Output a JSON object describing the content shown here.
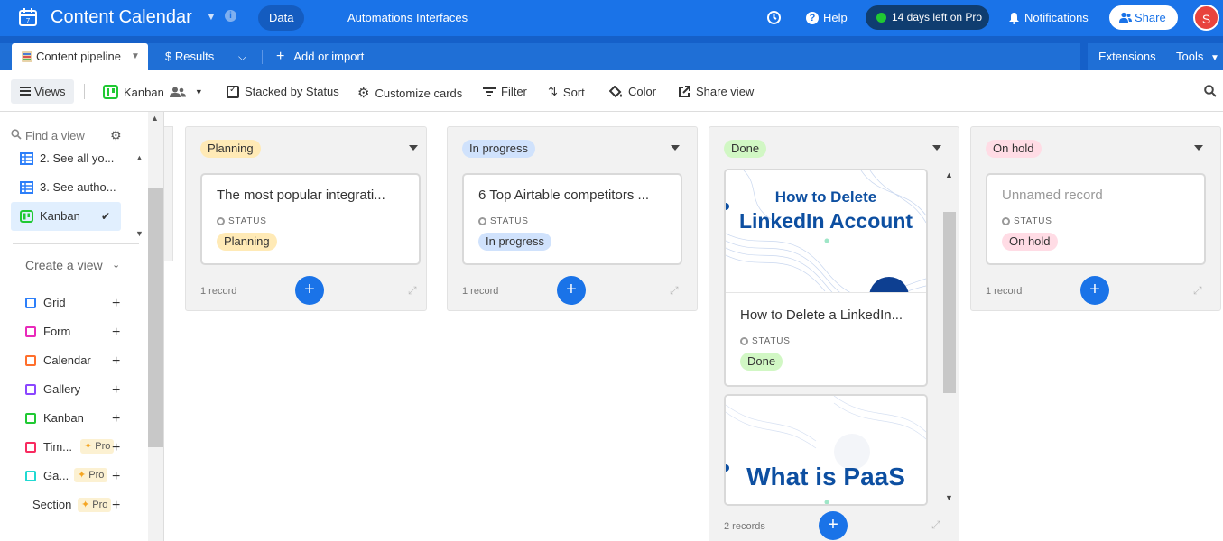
{
  "header": {
    "base_title": "Content Calendar",
    "nav": [
      {
        "label": "Data",
        "active": true
      },
      {
        "label": "Automations",
        "active": false
      },
      {
        "label": "Interfaces",
        "active": false
      }
    ],
    "help": "Help",
    "trial": "14 days left on Pro",
    "notifications": "Notifications",
    "share": "Share",
    "avatar_initial": "S",
    "accent": "#1a73e8"
  },
  "tables": {
    "active": "Content pipeline",
    "results": "$ Results",
    "add": "Add or import",
    "extensions": "Extensions",
    "tools": "Tools"
  },
  "toolbar": {
    "views": "Views",
    "view_name": "Kanban",
    "stacked": "Stacked by Status",
    "customize": "Customize cards",
    "filter": "Filter",
    "sort": "Sort",
    "color": "Color",
    "share_view": "Share view"
  },
  "sidebar": {
    "find_placeholder": "Find a view",
    "views": [
      {
        "label": "2. See all yo...",
        "icon": "grid-icon"
      },
      {
        "label": "3. See autho...",
        "icon": "grid-icon"
      },
      {
        "label": "Kanban",
        "icon": "kanban-icon",
        "selected": true
      }
    ],
    "create_label": "Create a view",
    "create_items": [
      {
        "label": "Grid",
        "color": "#2d7ff9"
      },
      {
        "label": "Form",
        "color": "#e929ba"
      },
      {
        "label": "Calendar",
        "color": "#ff6f2c"
      },
      {
        "label": "Gallery",
        "color": "#8b46ff"
      },
      {
        "label": "Kanban",
        "color": "#20c933"
      },
      {
        "label": "Tim...",
        "color": "#f82b60",
        "pro": "Pro"
      },
      {
        "label": "Ga...",
        "color": "#20d9d2",
        "pro": "Pro"
      },
      {
        "label": "Section",
        "pro": "Pro"
      }
    ]
  },
  "board": {
    "field_label": "STATUS",
    "columns": [
      {
        "status": "Planning",
        "color": "#ffeab6",
        "cards": [
          {
            "title": "The most popular integrati...",
            "status": "Planning"
          }
        ],
        "count": "1 record"
      },
      {
        "status": "In progress",
        "color": "#d0e2fc",
        "cards": [
          {
            "title": "6 Top Airtable competitors ...",
            "status": "In progress"
          }
        ],
        "count": "1 record"
      },
      {
        "status": "Done",
        "color": "#d1f7c4",
        "cards": [
          {
            "title": "How to Delete a LinkedIn...",
            "status": "Done",
            "thumb_line1": "How to Delete",
            "thumb_line2": "LinkedIn Account"
          },
          {
            "thumb_line1": "What is PaaS"
          }
        ],
        "count": "2 records"
      },
      {
        "status": "On hold",
        "color": "#ffdce5",
        "cards": [
          {
            "title": "Unnamed record",
            "status": "On hold"
          }
        ],
        "count": "1 record"
      }
    ]
  }
}
